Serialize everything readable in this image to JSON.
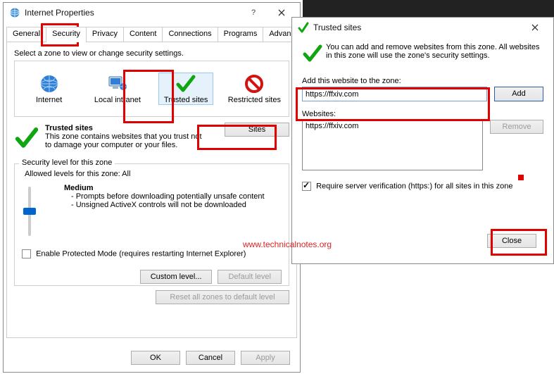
{
  "dlg1": {
    "title": "Internet Properties",
    "tabs": [
      "General",
      "Security",
      "Privacy",
      "Content",
      "Connections",
      "Programs",
      "Advanced"
    ],
    "active_tab": 1,
    "zone_prompt": "Select a zone to view or change security settings.",
    "zones": [
      "Internet",
      "Local intranet",
      "Trusted sites",
      "Restricted sites"
    ],
    "trusted": {
      "heading": "Trusted sites",
      "desc": "This zone contains websites that you trust not to damage your computer or your files."
    },
    "sites_btn": "Sites",
    "group_legend": "Security level for this zone",
    "allowed": "Allowed levels for this zone: All",
    "level_name": "Medium",
    "bullet1": "- Prompts before downloading potentially unsafe content",
    "bullet2": "- Unsigned ActiveX controls will not be downloaded",
    "protected": "Enable Protected Mode (requires restarting Internet Explorer)",
    "custom_btn": "Custom level...",
    "default_btn": "Default level",
    "reset_btn": "Reset all zones to default level",
    "ok": "OK",
    "cancel": "Cancel",
    "apply": "Apply"
  },
  "dlg2": {
    "title": "Trusted sites",
    "banner": "You can add and remove websites from this zone. All websites in this zone will use the zone's security settings.",
    "add_label": "Add this website to the zone:",
    "input_value": "https://ffxiv.com",
    "add_btn": "Add",
    "websites_label": "Websites:",
    "list_item": "https://ffxiv.com",
    "remove_btn": "Remove",
    "require": "Require server verification (https:) for all sites in this zone",
    "close_btn": "Close"
  },
  "watermark": "www.technicalnotes.org",
  "annotations": {
    "color": "#e00000",
    "boxes": [
      "tab-security",
      "zone-trusted",
      "sites-button",
      "add-field-row",
      "close-button"
    ]
  }
}
